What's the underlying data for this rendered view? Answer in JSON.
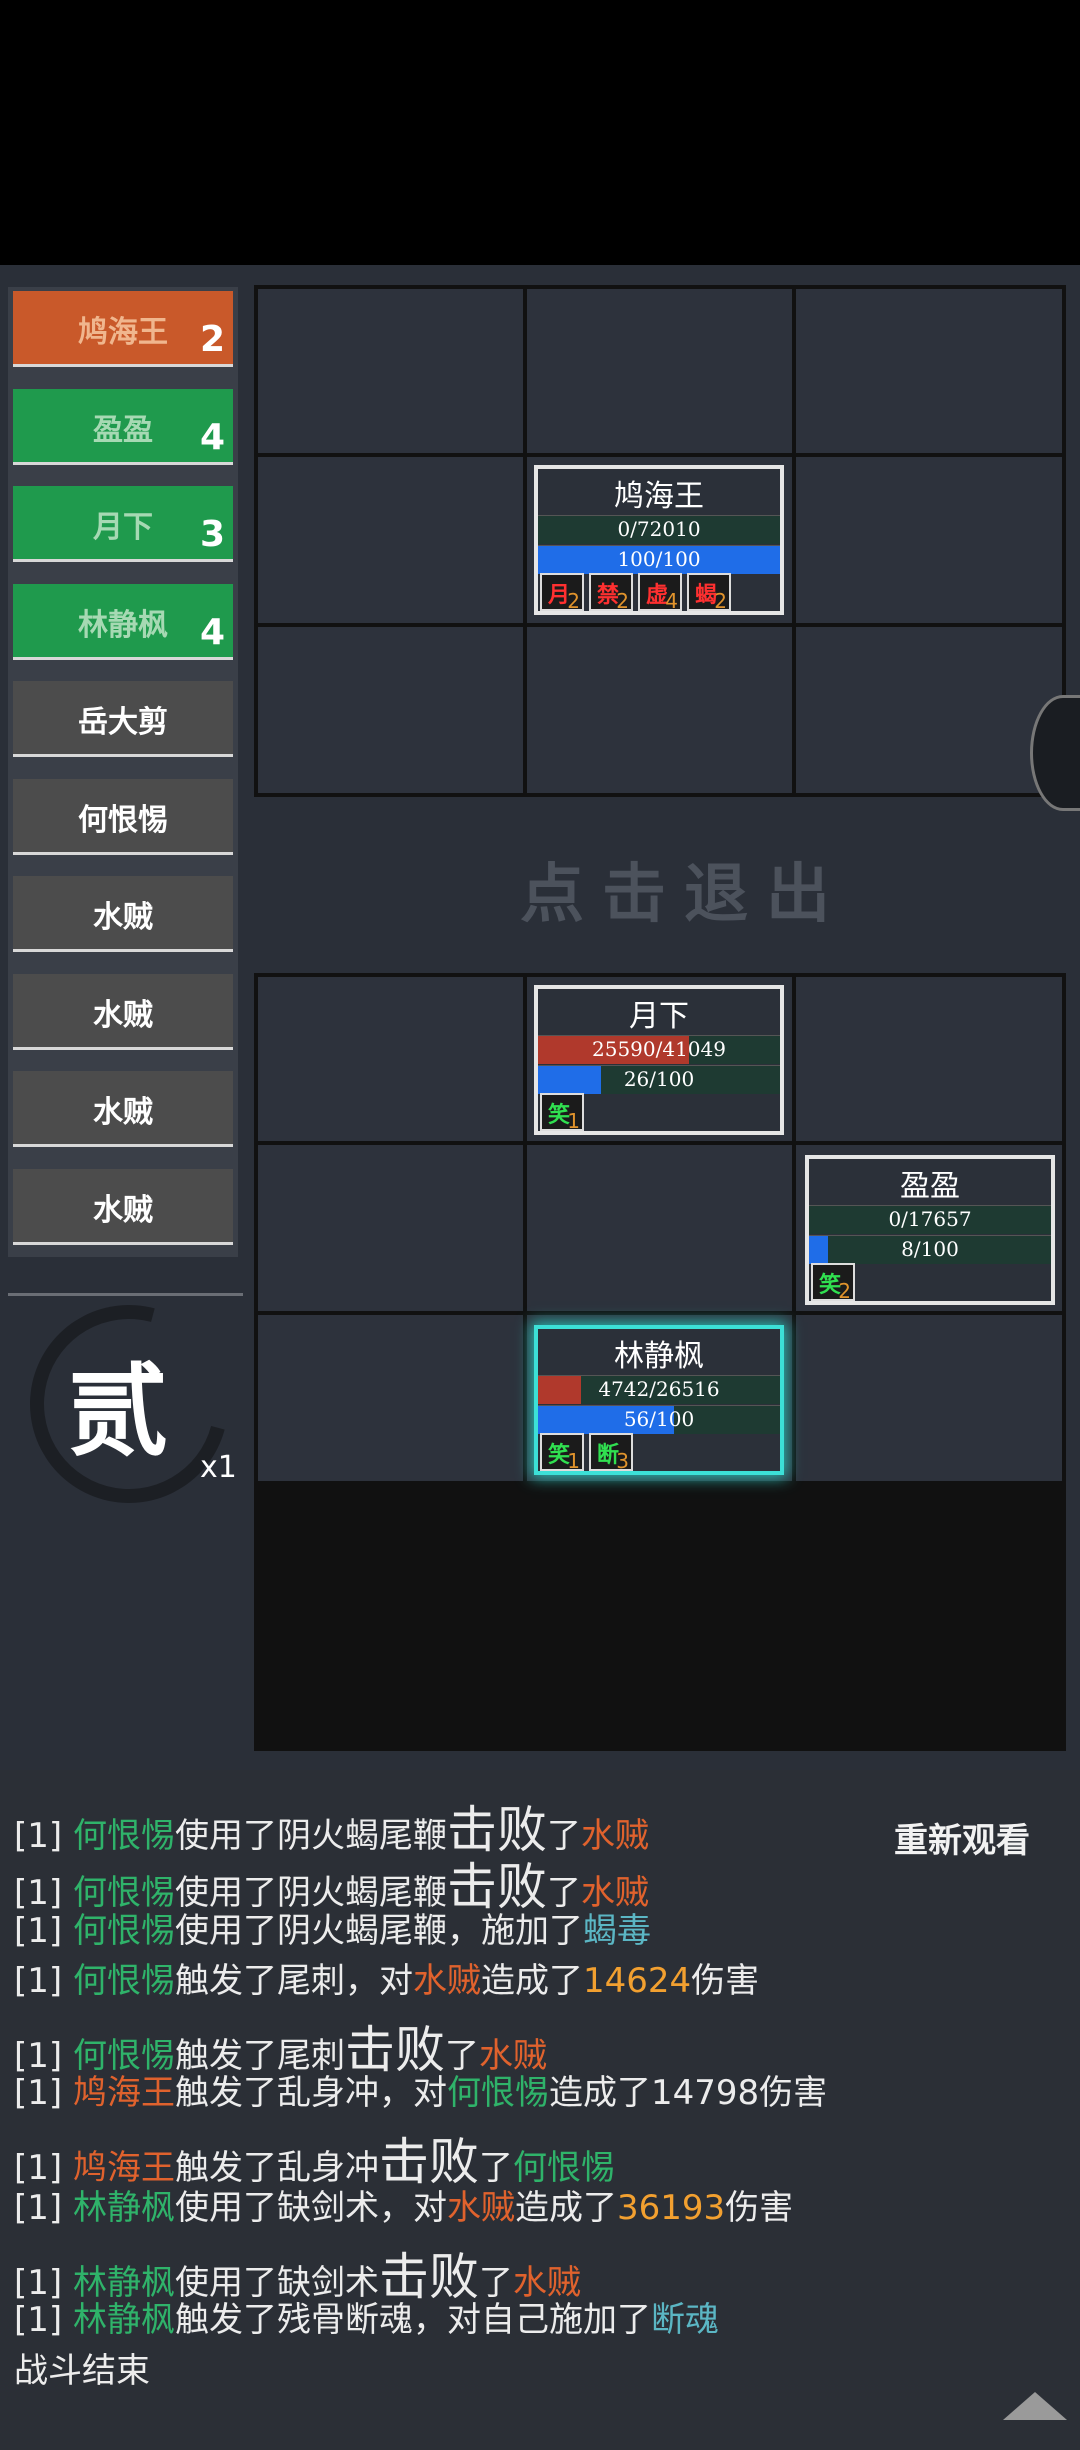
{
  "roster": [
    {
      "name": "鸠海王",
      "count": "2",
      "color": "orange"
    },
    {
      "name": "盈盈",
      "count": "4",
      "color": "green"
    },
    {
      "name": "月下",
      "count": "3",
      "color": "green"
    },
    {
      "name": "林静枫",
      "count": "4",
      "color": "green"
    },
    {
      "name": "岳大剪",
      "count": "",
      "color": "gray"
    },
    {
      "name": "何恨惕",
      "count": "",
      "color": "gray"
    },
    {
      "name": "水贼",
      "count": "",
      "color": "gray"
    },
    {
      "name": "水贼",
      "count": "",
      "color": "gray"
    },
    {
      "name": "水贼",
      "count": "",
      "color": "gray"
    },
    {
      "name": "水贼",
      "count": "",
      "color": "gray"
    }
  ],
  "round": {
    "char": "贰",
    "multiplier": "x1"
  },
  "exit_hint": "点击退出",
  "replay_label": "重新观看",
  "units": {
    "enemy_boss": {
      "name": "鸠海王",
      "hp_text": "0/72010",
      "hp_frac": 0.0,
      "mp_text": "100/100",
      "mp_frac": 1.0,
      "statuses": [
        {
          "glyph": "月",
          "num": "2",
          "color": "#ff3030"
        },
        {
          "glyph": "禁",
          "num": "2",
          "color": "#ff3030"
        },
        {
          "glyph": "虚",
          "num": "4",
          "color": "#ff3030"
        },
        {
          "glyph": "蝎",
          "num": "2",
          "color": "#ff3030"
        }
      ]
    },
    "yuexia": {
      "name": "月下",
      "hp_text": "25590/41049",
      "hp_frac": 0.623,
      "mp_text": "26/100",
      "mp_frac": 0.26,
      "statuses": [
        {
          "glyph": "笑",
          "num": "1",
          "color": "#30e050"
        }
      ]
    },
    "yingying": {
      "name": "盈盈",
      "hp_text": "0/17657",
      "hp_frac": 0.0,
      "mp_text": "8/100",
      "mp_frac": 0.08,
      "statuses": [
        {
          "glyph": "笑",
          "num": "2",
          "color": "#30e050"
        }
      ]
    },
    "linjingfeng": {
      "name": "林静枫",
      "hp_text": "4742/26516",
      "hp_frac": 0.179,
      "mp_text": "56/100",
      "mp_frac": 0.56,
      "statuses": [
        {
          "glyph": "笑",
          "num": "1",
          "color": "#30e050"
        },
        {
          "glyph": "断",
          "num": "3",
          "color": "#30e050"
        }
      ]
    }
  },
  "log": [
    {
      "segs": [
        [
          "[1] ",
          ""
        ],
        [
          "何恨惕",
          "green"
        ],
        [
          "使用了阴火蝎尾鞭",
          ""
        ],
        [
          "击败",
          "big"
        ],
        [
          "了",
          ""
        ],
        [
          "水贼",
          "orange"
        ]
      ]
    },
    {
      "segs": [
        [
          "[1] ",
          ""
        ],
        [
          "何恨惕",
          "green"
        ],
        [
          "使用了阴火蝎尾鞭",
          ""
        ],
        [
          "击败",
          "big"
        ],
        [
          "了",
          ""
        ],
        [
          "水贼",
          "orange"
        ]
      ]
    },
    {
      "segs": [
        [
          "[1] ",
          ""
        ],
        [
          "何恨惕",
          "green"
        ],
        [
          "使用了阴火蝎尾鞭，施加了",
          ""
        ],
        [
          "蝎毒",
          "teal"
        ]
      ]
    },
    {
      "segs": [
        [
          "[1] ",
          ""
        ],
        [
          "何恨惕",
          "green"
        ],
        [
          "触发了尾刺，对",
          ""
        ],
        [
          "水贼",
          "orange"
        ],
        [
          "造成了",
          ""
        ],
        [
          "14624",
          "gold"
        ],
        [
          "伤害",
          ""
        ]
      ]
    },
    {
      "segs": [
        [
          "[1] ",
          ""
        ],
        [
          "何恨惕",
          "green"
        ],
        [
          "触发了尾刺",
          ""
        ],
        [
          "击败",
          "big"
        ],
        [
          "了",
          ""
        ],
        [
          "水贼",
          "orange"
        ]
      ]
    },
    {
      "segs": [
        [
          "[1] ",
          ""
        ],
        [
          "鸠海王",
          "orange"
        ],
        [
          "触发了乱身冲，对",
          ""
        ],
        [
          "何恨惕",
          "green"
        ],
        [
          "造成了14798伤害",
          ""
        ]
      ]
    },
    {
      "segs": [
        [
          "[1] ",
          ""
        ],
        [
          "鸠海王",
          "orange"
        ],
        [
          "触发了乱身冲",
          ""
        ],
        [
          "击败",
          "big"
        ],
        [
          "了",
          ""
        ],
        [
          "何恨惕",
          "green"
        ]
      ]
    },
    {
      "segs": [
        [
          "[1] ",
          ""
        ],
        [
          "林静枫",
          "green"
        ],
        [
          "使用了缺剑术，对",
          ""
        ],
        [
          "水贼",
          "orange"
        ],
        [
          "造成了",
          ""
        ],
        [
          "36193",
          "gold"
        ],
        [
          "伤害",
          ""
        ]
      ]
    },
    {
      "segs": [
        [
          "[1] ",
          ""
        ],
        [
          "林静枫",
          "green"
        ],
        [
          "使用了缺剑术",
          ""
        ],
        [
          "击败",
          "big"
        ],
        [
          "了",
          ""
        ],
        [
          "水贼",
          "orange"
        ]
      ]
    },
    {
      "segs": [
        [
          "[1] ",
          ""
        ],
        [
          "林静枫",
          "green"
        ],
        [
          "触发了残骨断魂，对自己施加了",
          ""
        ],
        [
          "断魂",
          "teal"
        ]
      ]
    },
    {
      "segs": [
        [
          "战斗结束",
          ""
        ]
      ]
    }
  ]
}
